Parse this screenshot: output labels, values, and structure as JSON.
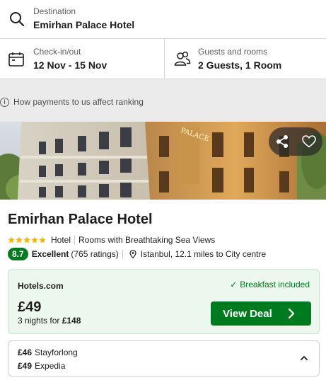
{
  "search": {
    "destination_label": "Destination",
    "destination_value": "Emirhan Palace Hotel",
    "dates_label": "Check-in/out",
    "dates_value": "12 Nov - 15 Nov",
    "guests_label": "Guests and rooms",
    "guests_value": "2 Guests, 1 Room"
  },
  "ranking_link": "How payments to us affect ranking",
  "hotel": {
    "name": "Emirhan Palace Hotel",
    "star_rating": 5,
    "type": "Hotel",
    "tagline": "Rooms with Breathtaking Sea Views",
    "score": "8.7",
    "score_label": "Excellent",
    "ratings_count": "(765 ratings)",
    "location": "Istanbul, 12.1 miles to City centre",
    "photo_sign": "PALACE"
  },
  "deal": {
    "provider": "Hotels.com",
    "breakfast": "Breakfast included",
    "price": "£49",
    "nights_prefix": "3 nights for ",
    "nights_total": "£148",
    "button_label": "View Deal"
  },
  "alternatives": [
    {
      "price": "£46",
      "provider": "Stayforlong"
    },
    {
      "price": "£49",
      "provider": "Expedia"
    }
  ],
  "icons": {
    "destination": "search-icon",
    "dates": "calendar-icon",
    "guests": "people-icon",
    "info": "info-icon",
    "share": "share-icon",
    "favorite": "heart-icon",
    "location": "location-pin-icon",
    "check": "check-icon",
    "view_deal": "chevron-right-icon",
    "alternatives_toggle": "chevron-up-icon"
  },
  "colors": {
    "accent_green": "#007a1f",
    "deal_background": "#ecf8ee",
    "star_gold": "#f5b400"
  }
}
